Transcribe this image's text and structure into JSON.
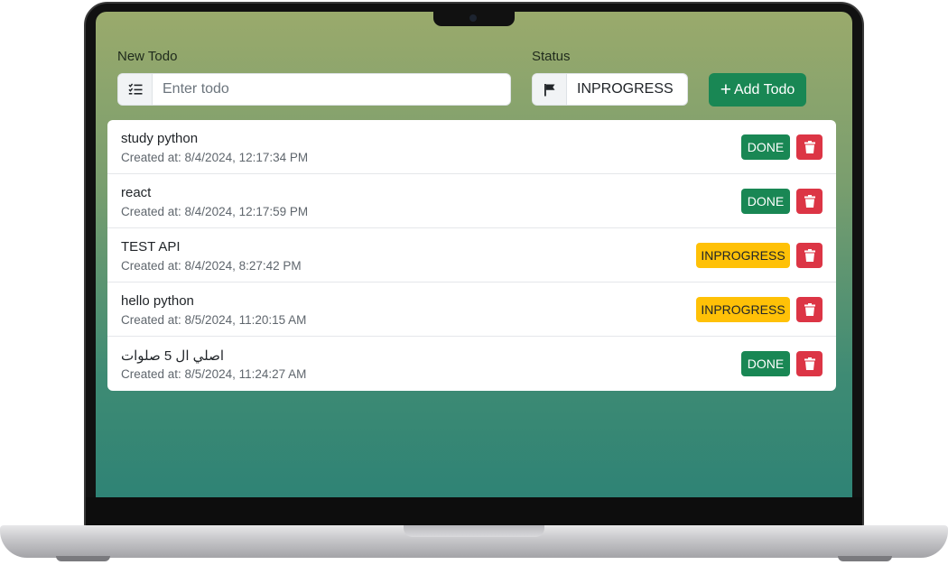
{
  "form": {
    "todo_label": "New Todo",
    "todo_placeholder": "Enter todo",
    "status_label": "Status",
    "status_value": "INPROGRESS",
    "add_button_label": "Add Todo",
    "add_button_icon": "plus-icon"
  },
  "todos": [
    {
      "title": "study python",
      "created": "Created at: 8/4/2024, 12:17:34 PM",
      "status": "DONE"
    },
    {
      "title": "react",
      "created": "Created at: 8/4/2024, 12:17:59 PM",
      "status": "DONE"
    },
    {
      "title": "TEST API",
      "created": "Created at: 8/4/2024, 8:27:42 PM",
      "status": "INPROGRESS"
    },
    {
      "title": "hello python",
      "created": "Created at: 8/5/2024, 11:20:15 AM",
      "status": "INPROGRESS"
    },
    {
      "title": "اصلي ال 5 صلوات",
      "created": "Created at: 8/5/2024, 11:24:27 AM",
      "status": "DONE"
    }
  ],
  "colors": {
    "done": "#198754",
    "inprogress": "#ffc107",
    "delete": "#dc3545",
    "add_button": "#198754"
  },
  "icons": {
    "todo_field": "list-check-icon",
    "status_field": "flag-icon",
    "delete": "trash-icon"
  }
}
